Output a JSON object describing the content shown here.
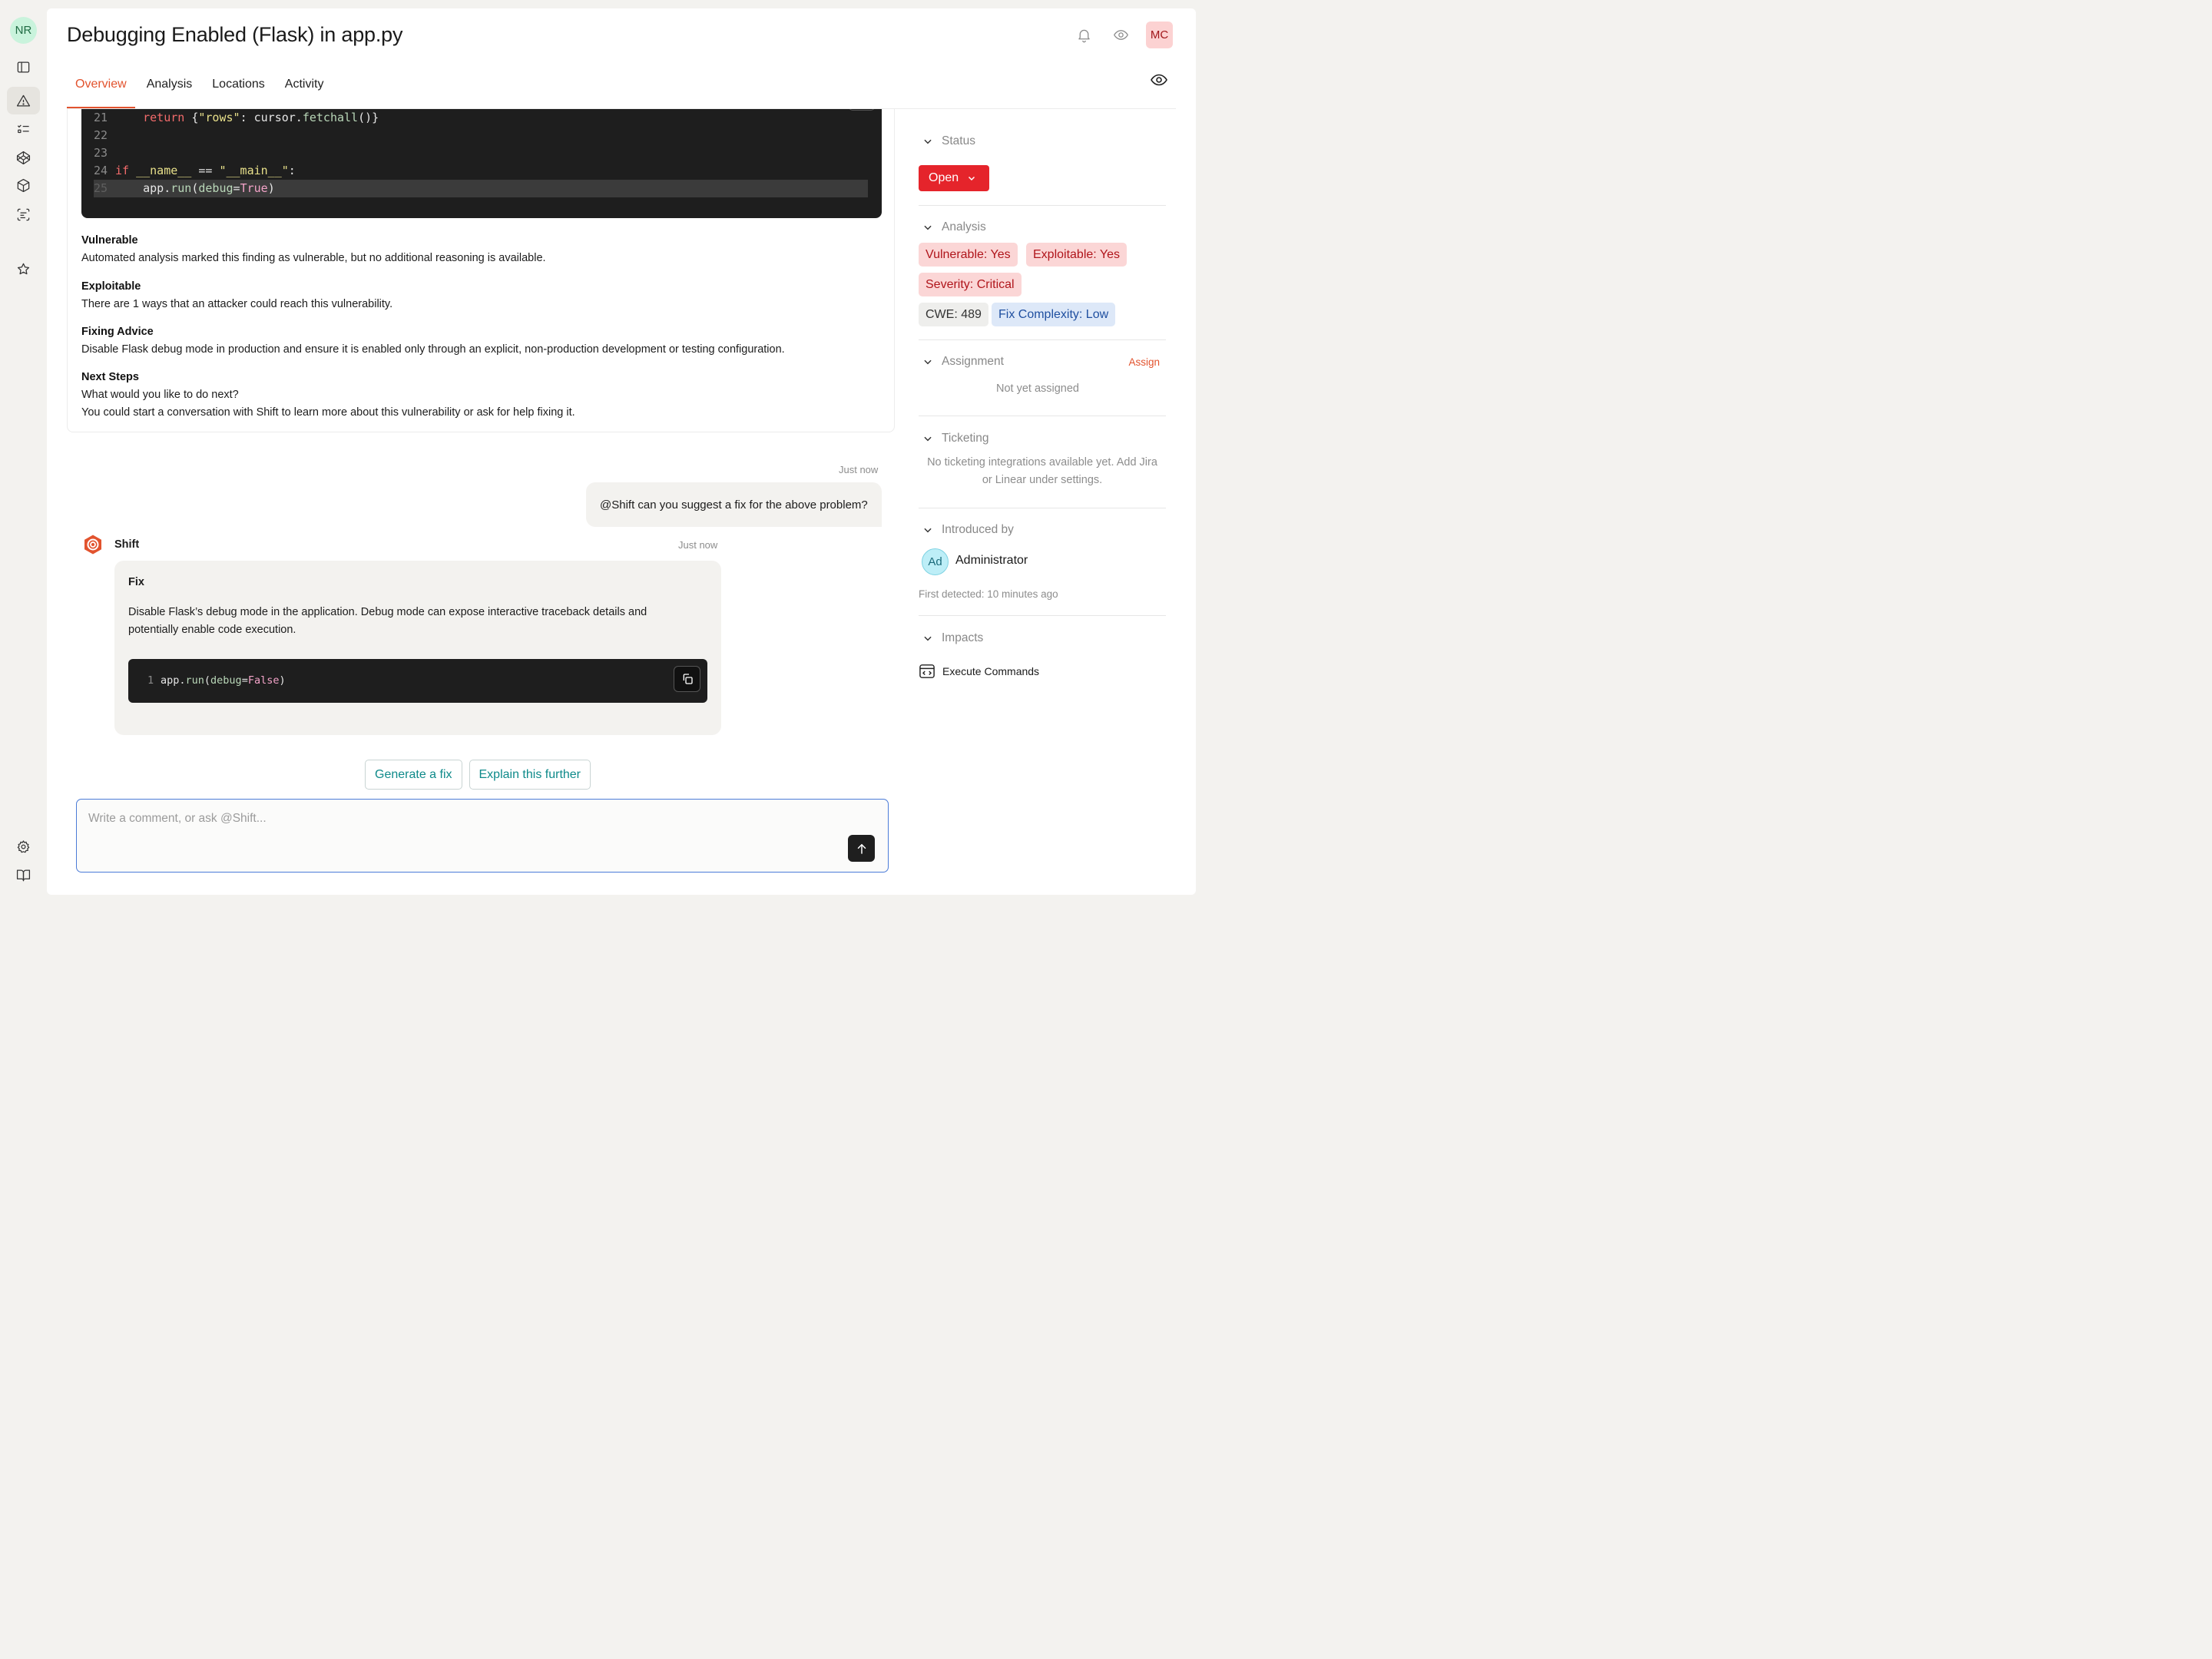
{
  "user_initials": "NR",
  "page": {
    "title": "Debugging Enabled (Flask) in app.py",
    "tabs": [
      "Overview",
      "Analysis",
      "Locations",
      "Activity"
    ],
    "user_badge": "MC"
  },
  "code_snippet": {
    "lines": [
      {
        "num": "21",
        "text": "    return {\"rows\": cursor.fetchall()}"
      },
      {
        "num": "22",
        "text": ""
      },
      {
        "num": "23",
        "text": ""
      },
      {
        "num": "24",
        "text": "if __name__ == \"__main__\":"
      },
      {
        "num": "25",
        "text": "    app.run(debug=True)"
      }
    ]
  },
  "overview": {
    "vulnerable_title": "Vulnerable",
    "vulnerable_text": "Automated analysis marked this finding as vulnerable, but no additional reasoning is available.",
    "exploitable_title": "Exploitable",
    "exploitable_text": "There are 1 ways that an attacker could reach this vulnerability.",
    "advice_title": "Fixing Advice",
    "advice_text": "Disable Flask debug mode in production and ensure it is enabled only through an explicit, non-production development or testing configuration.",
    "next_title": "Next Steps",
    "next_line1": "What would you like to do next?",
    "next_line2": "You could start a conversation with Shift to learn more about this vulnerability or ask for help fixing it."
  },
  "chat": {
    "user_time": "Just now",
    "user_message": "@Shift can you suggest a fix for the above problem?",
    "bot_name": "Shift",
    "bot_time": "Just now",
    "bot_heading": "Fix",
    "bot_text": "Disable Flask’s debug mode in the application. Debug mode can expose interactive traceback details and potentially enable code execution.",
    "bot_code_line": "1",
    "bot_code": "app.run(debug=False)",
    "suggestions": [
      "Generate a fix",
      "Explain this further"
    ],
    "composer_placeholder": "Write a comment, or ask @Shift..."
  },
  "sidebar": {
    "status": {
      "label": "Status",
      "value": "Open"
    },
    "analysis": {
      "label": "Analysis",
      "vulnerable": "Vulnerable: Yes",
      "exploitable": "Exploitable: Yes",
      "severity": "Severity: Critical",
      "cwe": "CWE: 489",
      "complexity": "Fix Complexity: Low"
    },
    "assignment": {
      "label": "Assignment",
      "action": "Assign",
      "empty": "Not yet assigned"
    },
    "ticketing": {
      "label": "Ticketing",
      "empty": "No ticketing integrations available yet. Add Jira or Linear under settings."
    },
    "introduced": {
      "label": "Introduced by",
      "initials": "Ad",
      "name": "Administrator",
      "detected": "First detected: 10 minutes ago"
    },
    "impacts": {
      "label": "Impacts",
      "item": "Execute Commands"
    }
  },
  "colors": {
    "accent": "#e2532e",
    "status_open": "#e5242b",
    "link_teal": "#0e8a8a",
    "focus_blue": "#4b7bd8"
  }
}
